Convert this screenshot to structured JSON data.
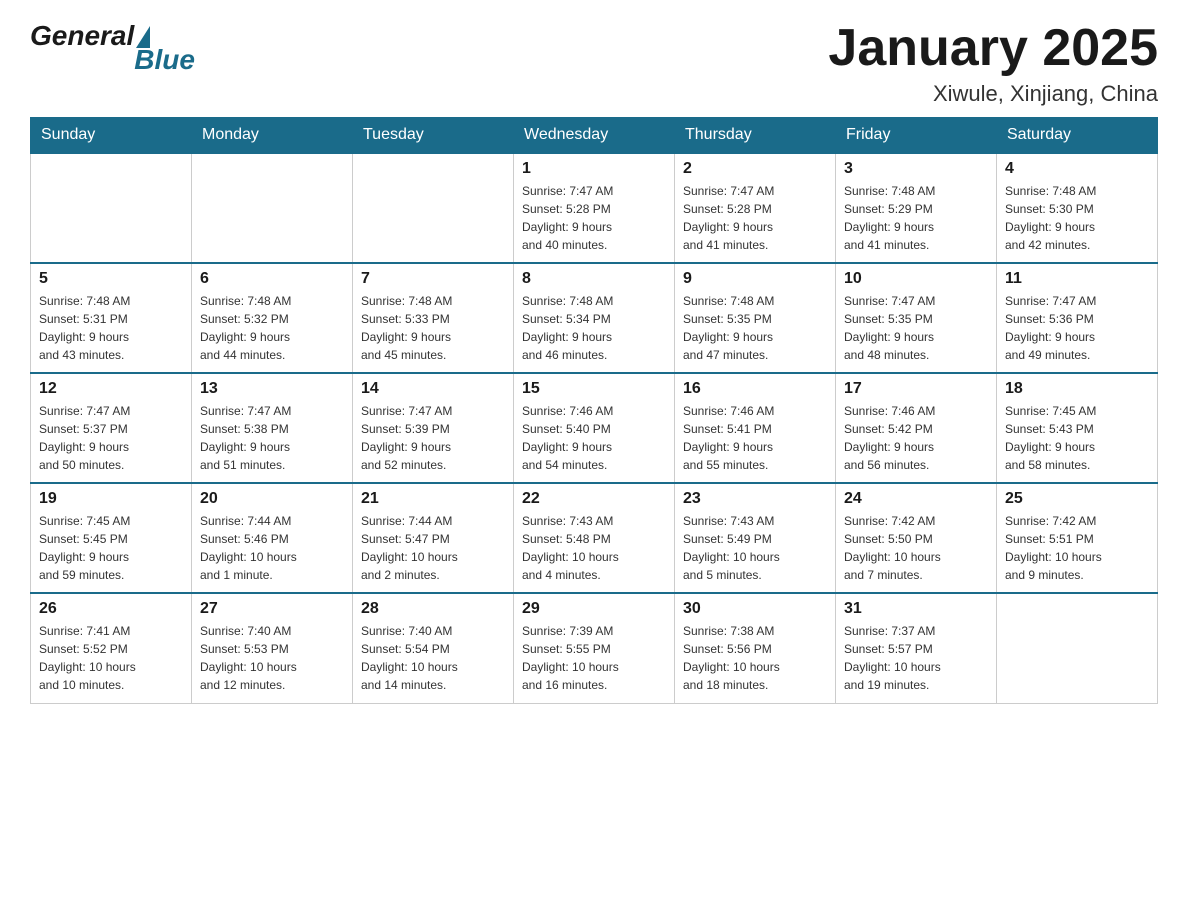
{
  "logo": {
    "general": "General",
    "blue": "Blue"
  },
  "header": {
    "title": "January 2025",
    "location": "Xiwule, Xinjiang, China"
  },
  "days_of_week": [
    "Sunday",
    "Monday",
    "Tuesday",
    "Wednesday",
    "Thursday",
    "Friday",
    "Saturday"
  ],
  "weeks": [
    [
      {
        "day": "",
        "info": ""
      },
      {
        "day": "",
        "info": ""
      },
      {
        "day": "",
        "info": ""
      },
      {
        "day": "1",
        "info": "Sunrise: 7:47 AM\nSunset: 5:28 PM\nDaylight: 9 hours\nand 40 minutes."
      },
      {
        "day": "2",
        "info": "Sunrise: 7:47 AM\nSunset: 5:28 PM\nDaylight: 9 hours\nand 41 minutes."
      },
      {
        "day": "3",
        "info": "Sunrise: 7:48 AM\nSunset: 5:29 PM\nDaylight: 9 hours\nand 41 minutes."
      },
      {
        "day": "4",
        "info": "Sunrise: 7:48 AM\nSunset: 5:30 PM\nDaylight: 9 hours\nand 42 minutes."
      }
    ],
    [
      {
        "day": "5",
        "info": "Sunrise: 7:48 AM\nSunset: 5:31 PM\nDaylight: 9 hours\nand 43 minutes."
      },
      {
        "day": "6",
        "info": "Sunrise: 7:48 AM\nSunset: 5:32 PM\nDaylight: 9 hours\nand 44 minutes."
      },
      {
        "day": "7",
        "info": "Sunrise: 7:48 AM\nSunset: 5:33 PM\nDaylight: 9 hours\nand 45 minutes."
      },
      {
        "day": "8",
        "info": "Sunrise: 7:48 AM\nSunset: 5:34 PM\nDaylight: 9 hours\nand 46 minutes."
      },
      {
        "day": "9",
        "info": "Sunrise: 7:48 AM\nSunset: 5:35 PM\nDaylight: 9 hours\nand 47 minutes."
      },
      {
        "day": "10",
        "info": "Sunrise: 7:47 AM\nSunset: 5:35 PM\nDaylight: 9 hours\nand 48 minutes."
      },
      {
        "day": "11",
        "info": "Sunrise: 7:47 AM\nSunset: 5:36 PM\nDaylight: 9 hours\nand 49 minutes."
      }
    ],
    [
      {
        "day": "12",
        "info": "Sunrise: 7:47 AM\nSunset: 5:37 PM\nDaylight: 9 hours\nand 50 minutes."
      },
      {
        "day": "13",
        "info": "Sunrise: 7:47 AM\nSunset: 5:38 PM\nDaylight: 9 hours\nand 51 minutes."
      },
      {
        "day": "14",
        "info": "Sunrise: 7:47 AM\nSunset: 5:39 PM\nDaylight: 9 hours\nand 52 minutes."
      },
      {
        "day": "15",
        "info": "Sunrise: 7:46 AM\nSunset: 5:40 PM\nDaylight: 9 hours\nand 54 minutes."
      },
      {
        "day": "16",
        "info": "Sunrise: 7:46 AM\nSunset: 5:41 PM\nDaylight: 9 hours\nand 55 minutes."
      },
      {
        "day": "17",
        "info": "Sunrise: 7:46 AM\nSunset: 5:42 PM\nDaylight: 9 hours\nand 56 minutes."
      },
      {
        "day": "18",
        "info": "Sunrise: 7:45 AM\nSunset: 5:43 PM\nDaylight: 9 hours\nand 58 minutes."
      }
    ],
    [
      {
        "day": "19",
        "info": "Sunrise: 7:45 AM\nSunset: 5:45 PM\nDaylight: 9 hours\nand 59 minutes."
      },
      {
        "day": "20",
        "info": "Sunrise: 7:44 AM\nSunset: 5:46 PM\nDaylight: 10 hours\nand 1 minute."
      },
      {
        "day": "21",
        "info": "Sunrise: 7:44 AM\nSunset: 5:47 PM\nDaylight: 10 hours\nand 2 minutes."
      },
      {
        "day": "22",
        "info": "Sunrise: 7:43 AM\nSunset: 5:48 PM\nDaylight: 10 hours\nand 4 minutes."
      },
      {
        "day": "23",
        "info": "Sunrise: 7:43 AM\nSunset: 5:49 PM\nDaylight: 10 hours\nand 5 minutes."
      },
      {
        "day": "24",
        "info": "Sunrise: 7:42 AM\nSunset: 5:50 PM\nDaylight: 10 hours\nand 7 minutes."
      },
      {
        "day": "25",
        "info": "Sunrise: 7:42 AM\nSunset: 5:51 PM\nDaylight: 10 hours\nand 9 minutes."
      }
    ],
    [
      {
        "day": "26",
        "info": "Sunrise: 7:41 AM\nSunset: 5:52 PM\nDaylight: 10 hours\nand 10 minutes."
      },
      {
        "day": "27",
        "info": "Sunrise: 7:40 AM\nSunset: 5:53 PM\nDaylight: 10 hours\nand 12 minutes."
      },
      {
        "day": "28",
        "info": "Sunrise: 7:40 AM\nSunset: 5:54 PM\nDaylight: 10 hours\nand 14 minutes."
      },
      {
        "day": "29",
        "info": "Sunrise: 7:39 AM\nSunset: 5:55 PM\nDaylight: 10 hours\nand 16 minutes."
      },
      {
        "day": "30",
        "info": "Sunrise: 7:38 AM\nSunset: 5:56 PM\nDaylight: 10 hours\nand 18 minutes."
      },
      {
        "day": "31",
        "info": "Sunrise: 7:37 AM\nSunset: 5:57 PM\nDaylight: 10 hours\nand 19 minutes."
      },
      {
        "day": "",
        "info": ""
      }
    ]
  ]
}
